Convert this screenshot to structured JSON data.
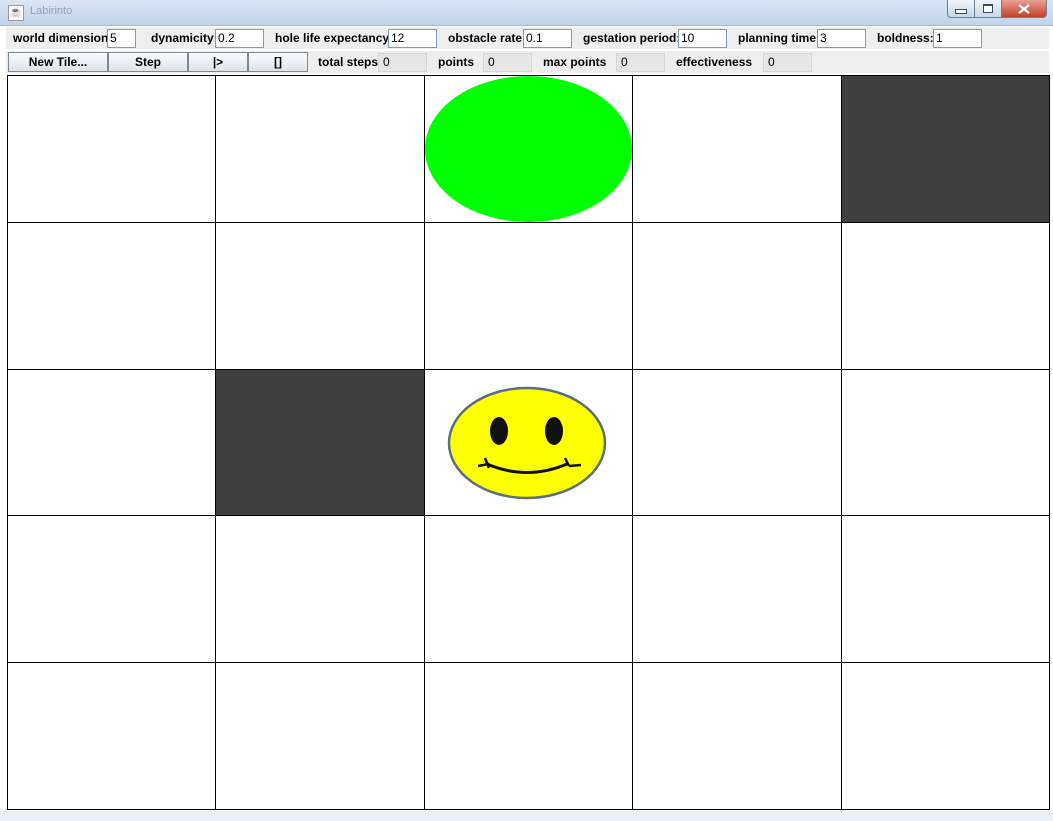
{
  "window": {
    "title": "Labirinto"
  },
  "params": {
    "world_dimension": {
      "label": "world dimension",
      "value": "5"
    },
    "dynamicity": {
      "label": "dynamicity:",
      "value": "0.2"
    },
    "hole_life": {
      "label": "hole life expectancy",
      "value": "12"
    },
    "obstacle_rate": {
      "label": "obstacle rate",
      "value": "0.1"
    },
    "gestation": {
      "label": "gestation period:",
      "value": "10"
    },
    "planning": {
      "label": "planning time:",
      "value": "3"
    },
    "boldness": {
      "label": "boldness:",
      "value": "1"
    }
  },
  "controls": {
    "new_tile": "New Tile...",
    "step": "Step",
    "play": "|>",
    "stop": "[]"
  },
  "stats": {
    "total_steps": {
      "label": "total steps",
      "value": "0"
    },
    "points": {
      "label": "points",
      "value": "0"
    },
    "max_points": {
      "label": "max points",
      "value": "0"
    },
    "effectiveness": {
      "label": "effectiveness",
      "value": "0"
    }
  },
  "grid": {
    "size": 5,
    "cells": [
      [
        "empty",
        "empty",
        "hole",
        "empty",
        "obstacle"
      ],
      [
        "empty",
        "empty",
        "empty",
        "empty",
        "empty"
      ],
      [
        "empty",
        "obstacle",
        "agent",
        "empty",
        "empty"
      ],
      [
        "empty",
        "empty",
        "empty",
        "empty",
        "empty"
      ],
      [
        "empty",
        "empty",
        "empty",
        "empty",
        "empty"
      ]
    ]
  },
  "colors": {
    "hole": "#00ff00",
    "obstacle": "#404040",
    "agent": "#ffff00"
  }
}
